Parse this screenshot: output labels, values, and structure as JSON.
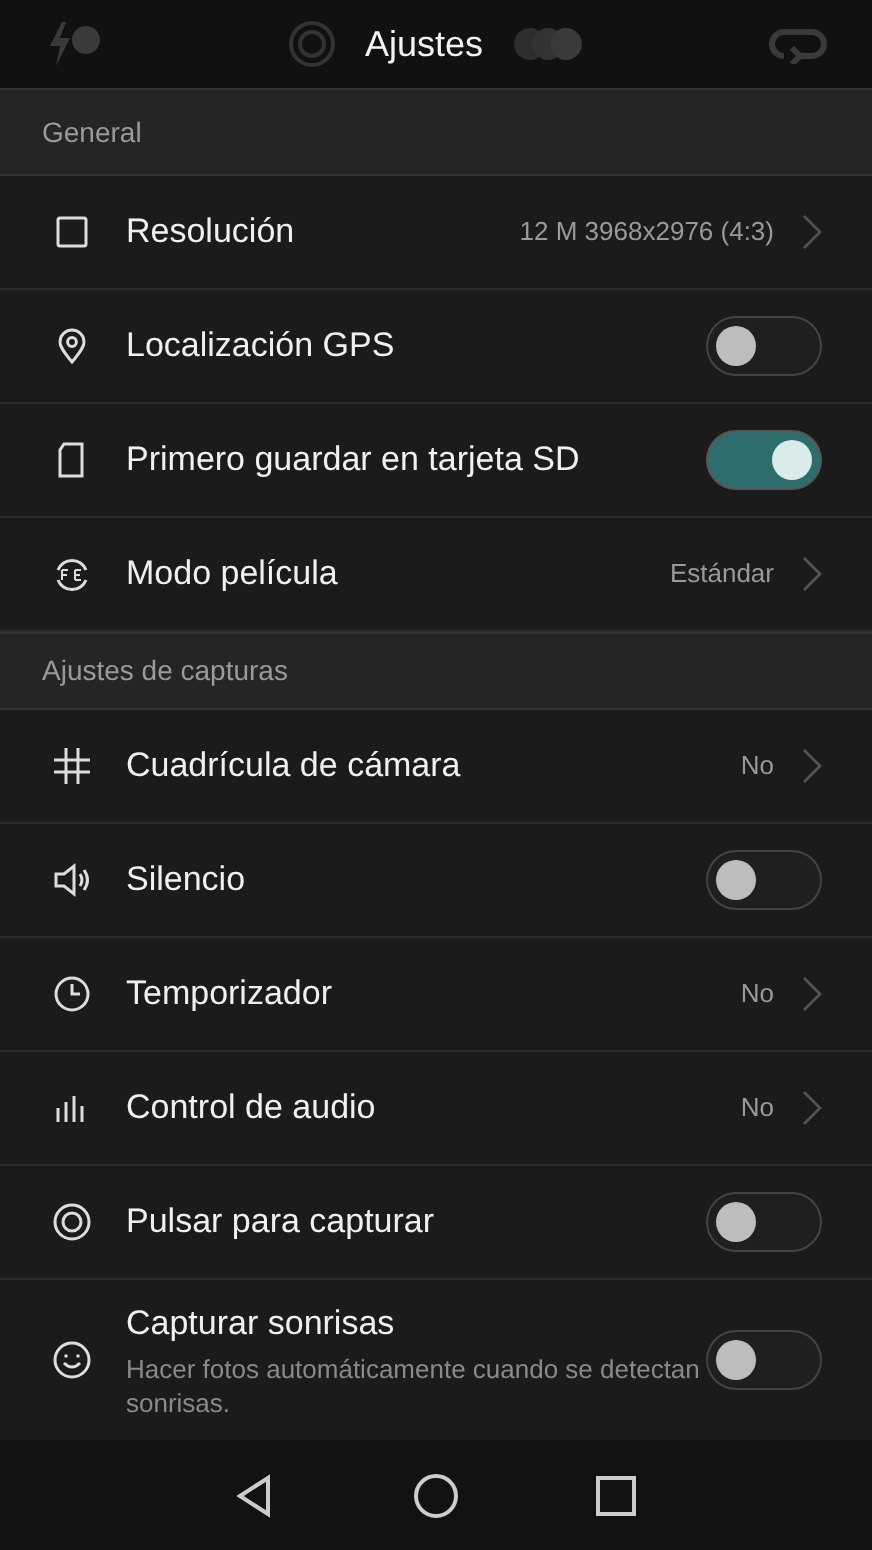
{
  "top_bar": {
    "title": "Ajustes"
  },
  "sections": [
    {
      "title": "General",
      "rows": [
        {
          "kind": "value",
          "label": "Resolución",
          "value": "12 M 3968x2976 (4:3)"
        },
        {
          "kind": "toggle",
          "label": "Localización GPS",
          "on": false
        },
        {
          "kind": "toggle",
          "label": "Primero guardar en tarjeta SD",
          "on": true
        },
        {
          "kind": "value",
          "label": "Modo película",
          "value": "Estándar"
        }
      ]
    },
    {
      "title": "Ajustes de capturas",
      "rows": [
        {
          "kind": "value",
          "label": "Cuadrícula de cámara",
          "value": "No"
        },
        {
          "kind": "toggle",
          "label": "Silencio",
          "on": false
        },
        {
          "kind": "value",
          "label": "Temporizador",
          "value": "No"
        },
        {
          "kind": "value",
          "label": "Control de audio",
          "value": "No"
        },
        {
          "kind": "toggle",
          "label": "Pulsar para capturar",
          "on": false
        },
        {
          "kind": "toggle",
          "label": "Capturar sonrisas",
          "subtitle": "Hacer fotos automáticamente cuando se detectan sonrisas.",
          "on": false
        }
      ]
    }
  ]
}
